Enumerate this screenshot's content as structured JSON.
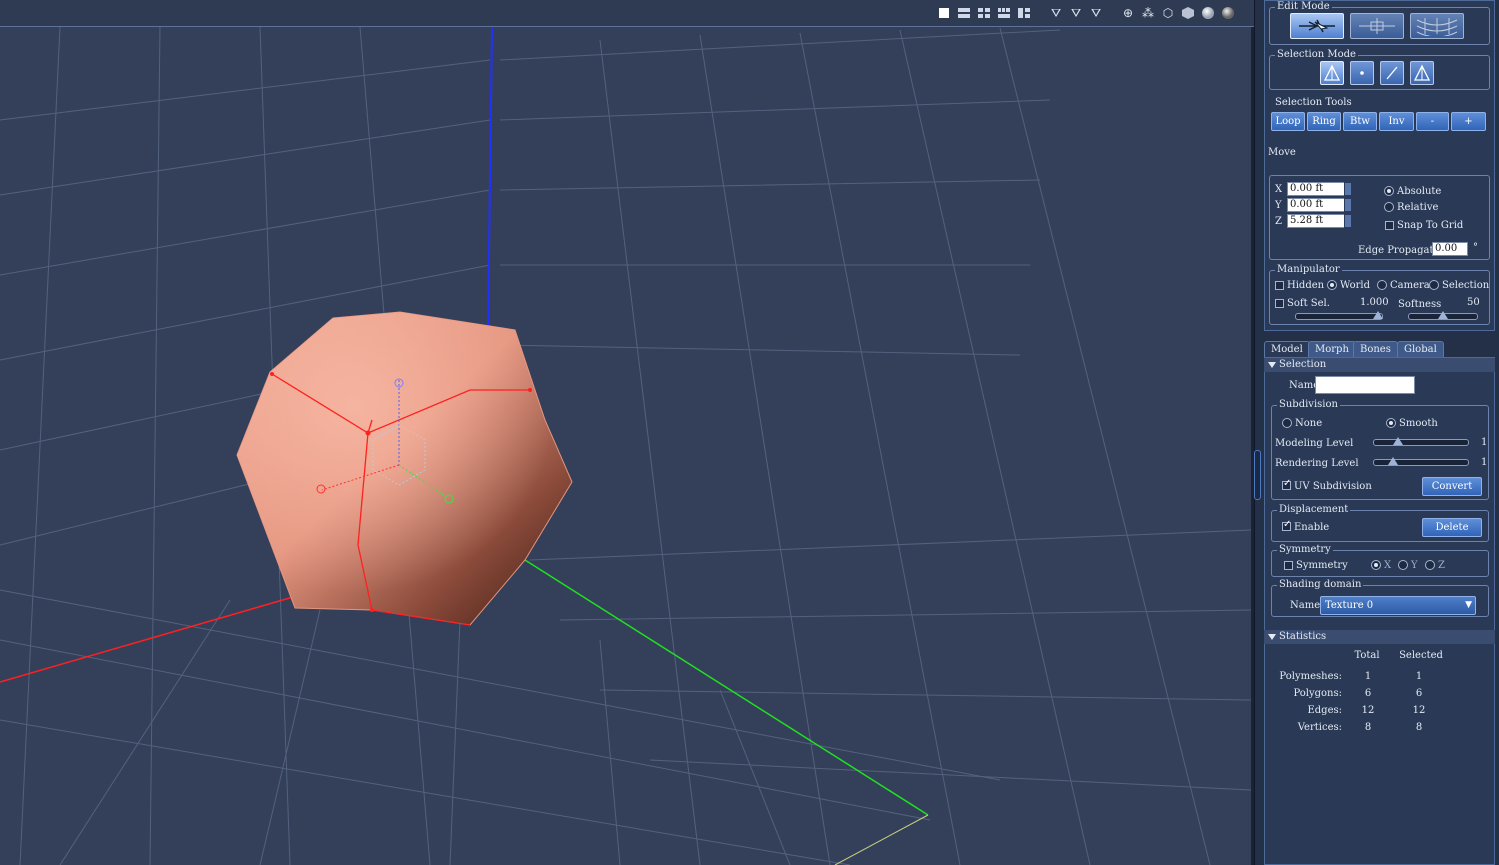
{
  "viewport_toolbar": {
    "icons": [
      "single-view-icon",
      "two-view-icon",
      "four-view-icon",
      "three-view-icon",
      "layout-view-icon",
      "wire-cage-icon",
      "hidden-line-icon",
      "lit-wire-icon",
      "box-icon",
      "wireframe-icon",
      "outline-icon",
      "flat-shaded-icon",
      "smooth-shaded-icon",
      "texture-shaded-icon"
    ]
  },
  "edit_mode": {
    "title": "Edit Mode",
    "buttons": [
      "select-move-icon",
      "weld-icon",
      "morph-brush-icon"
    ]
  },
  "selection_mode": {
    "title": "Selection Mode",
    "buttons": [
      "polygon-select-icon",
      "vertex-select-icon",
      "edge-select-icon",
      "polygon-select-icon-2"
    ]
  },
  "selection_tools": {
    "title": "Selection Tools",
    "buttons": [
      "Loop",
      "Ring",
      "Btw",
      "Inv",
      "-",
      "+"
    ]
  },
  "move": {
    "title": "Move",
    "x_label": "X",
    "x_value": "0.00 ft",
    "y_label": "Y",
    "y_value": "0.00 ft",
    "z_label": "Z",
    "z_value": "5.28 ft",
    "absolute": "Absolute",
    "relative": "Relative",
    "snap": "Snap To Grid",
    "edge_prop_label": "Edge Propagation",
    "edge_prop_value": "0.00",
    "degree": "°"
  },
  "manipulator": {
    "title": "Manipulator",
    "hidden": "Hidden",
    "world": "World",
    "camera": "Camera",
    "selection": "Selection",
    "soft_sel": "Soft Sel.",
    "soft_sel_value": "1.000",
    "softness": "Softness",
    "softness_value": "50"
  },
  "tabs": [
    "Model",
    "Morph",
    "Bones",
    "Global"
  ],
  "selection_section": {
    "title": "Selection",
    "name_label": "Name",
    "name_value": ""
  },
  "subdivision": {
    "title": "Subdivision",
    "none": "None",
    "smooth": "Smooth",
    "modeling_level": "Modeling Level",
    "modeling_value": "1",
    "rendering_level": "Rendering Level",
    "rendering_value": "1",
    "uv_subdivision": "UV Subdivision",
    "convert": "Convert"
  },
  "displacement": {
    "title": "Displacement",
    "enable": "Enable",
    "delete": "Delete"
  },
  "symmetry": {
    "title": "Symmetry",
    "label": "Symmetry",
    "x": "X",
    "y": "Y",
    "z": "Z"
  },
  "shading_domain": {
    "title": "Shading domain",
    "name_label": "Name",
    "value": "Texture 0"
  },
  "statistics": {
    "title": "Statistics",
    "col_total": "Total",
    "col_selected": "Selected",
    "rows": [
      {
        "label": "Polymeshes:",
        "total": "1",
        "selected": "1"
      },
      {
        "label": "Polygons:",
        "total": "6",
        "selected": "6"
      },
      {
        "label": "Edges:",
        "total": "12",
        "selected": "12"
      },
      {
        "label": "Vertices:",
        "total": "8",
        "selected": "8"
      }
    ]
  },
  "colors": {
    "viewport_bg": "#34405a",
    "object": "#e8a08a",
    "x_axis": "#ff2020",
    "y_axis": "#20e020",
    "z_axis": "#2030ff",
    "accent": "#4f80d0"
  }
}
